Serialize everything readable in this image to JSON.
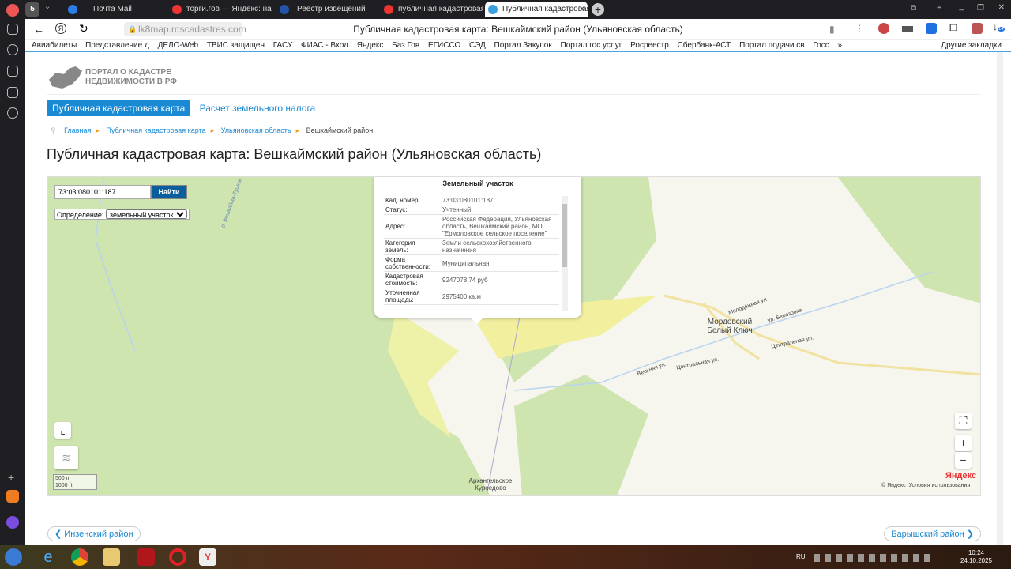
{
  "browser": {
    "tabs": [
      {
        "label": "Почта Mail",
        "color": "#2b7de9"
      },
      {
        "label": "торги.гов — Яндекс: наш",
        "color": "#e33"
      },
      {
        "label": "Реестр извещений",
        "color": "#2255aa"
      },
      {
        "label": "публичная кадастровая к",
        "color": "#e33"
      },
      {
        "label": "Публичная кадастровая",
        "color": "#3aa0e0"
      }
    ],
    "tab_count": "5",
    "url": "lk8map.roscadastres.com",
    "page_title": "Публичная кадастровая карта: Вешкаймский район (Ульяновская область)",
    "downloads_badge": "14",
    "bookmarks": [
      "Авиабилеты",
      "Представление д",
      "ДЕЛО-Web",
      "ТВИС защищен",
      "ГАСУ",
      "ФИАС - Вход",
      "Яндекс",
      "Баз Гов",
      "ЕГИССО",
      "СЭД",
      "Портал Закупок",
      "Портал гос услуг",
      "Росреестр",
      "Сбербанк-АСТ",
      "Портал подачи св",
      "Госс",
      "»"
    ],
    "other_bookmarks": "Другие закладки"
  },
  "site": {
    "logo_line1": "ПОРТАЛ О КАДАСТРЕ",
    "logo_line2": "НЕДВИЖИМОСТИ В РФ",
    "nav": [
      "Публичная кадастровая карта",
      "Расчет земельного налога"
    ],
    "breadcrumb": [
      "Главная",
      "Публичная кадастровая карта",
      "Ульяновская область",
      "Вешкаймский район"
    ],
    "heading": "Публичная кадастровая карта: Вешкаймский район (Ульяновская область)",
    "prev": "Инзенский район",
    "next": "Барышский район"
  },
  "map": {
    "search_value": "73:03:080101:187",
    "search_button": "Найти",
    "def_label": "Определение:",
    "def_value": "земельный участок",
    "popup": {
      "title": "Земельный участок",
      "rows": [
        {
          "k": "Кад. номер:",
          "v": "73:03:080101:187"
        },
        {
          "k": "Статус:",
          "v": "Учтенный"
        },
        {
          "k": "Адрес:",
          "v": "Российская Федерация, Ульяновская область, Вешкаймский район, МО \"Ермоловское сельское поселение\""
        },
        {
          "k": "Категория земель:",
          "v": "Земли сельскохозяйственного назначения"
        },
        {
          "k": "Форма собственности:",
          "v": "Муниципальная"
        },
        {
          "k": "Кадастровая стоимость:",
          "v": "9247078.74 руб"
        },
        {
          "k": "Уточненная площадь:",
          "v": "2975400 кв.м"
        }
      ]
    },
    "labels": {
      "village1": "Мордовский Белый Ключ",
      "village2": "Архангельское Куроедово",
      "street1": "Молодёжная ул.",
      "street2": "ул. Березовка",
      "street3": "Центральная ул.",
      "street4": "Центральная ул.",
      "street5": "Верхняя ул.",
      "river": "р. Вешкайма-Тушна"
    },
    "scale_m": "500 m",
    "scale_ft": "1000 ft",
    "yandex": "Яндекс",
    "copyright": "© Яндекс",
    "terms": "Условия использования"
  },
  "taskbar": {
    "lang": "RU",
    "time": "10:24",
    "date": "24.10.2025"
  }
}
